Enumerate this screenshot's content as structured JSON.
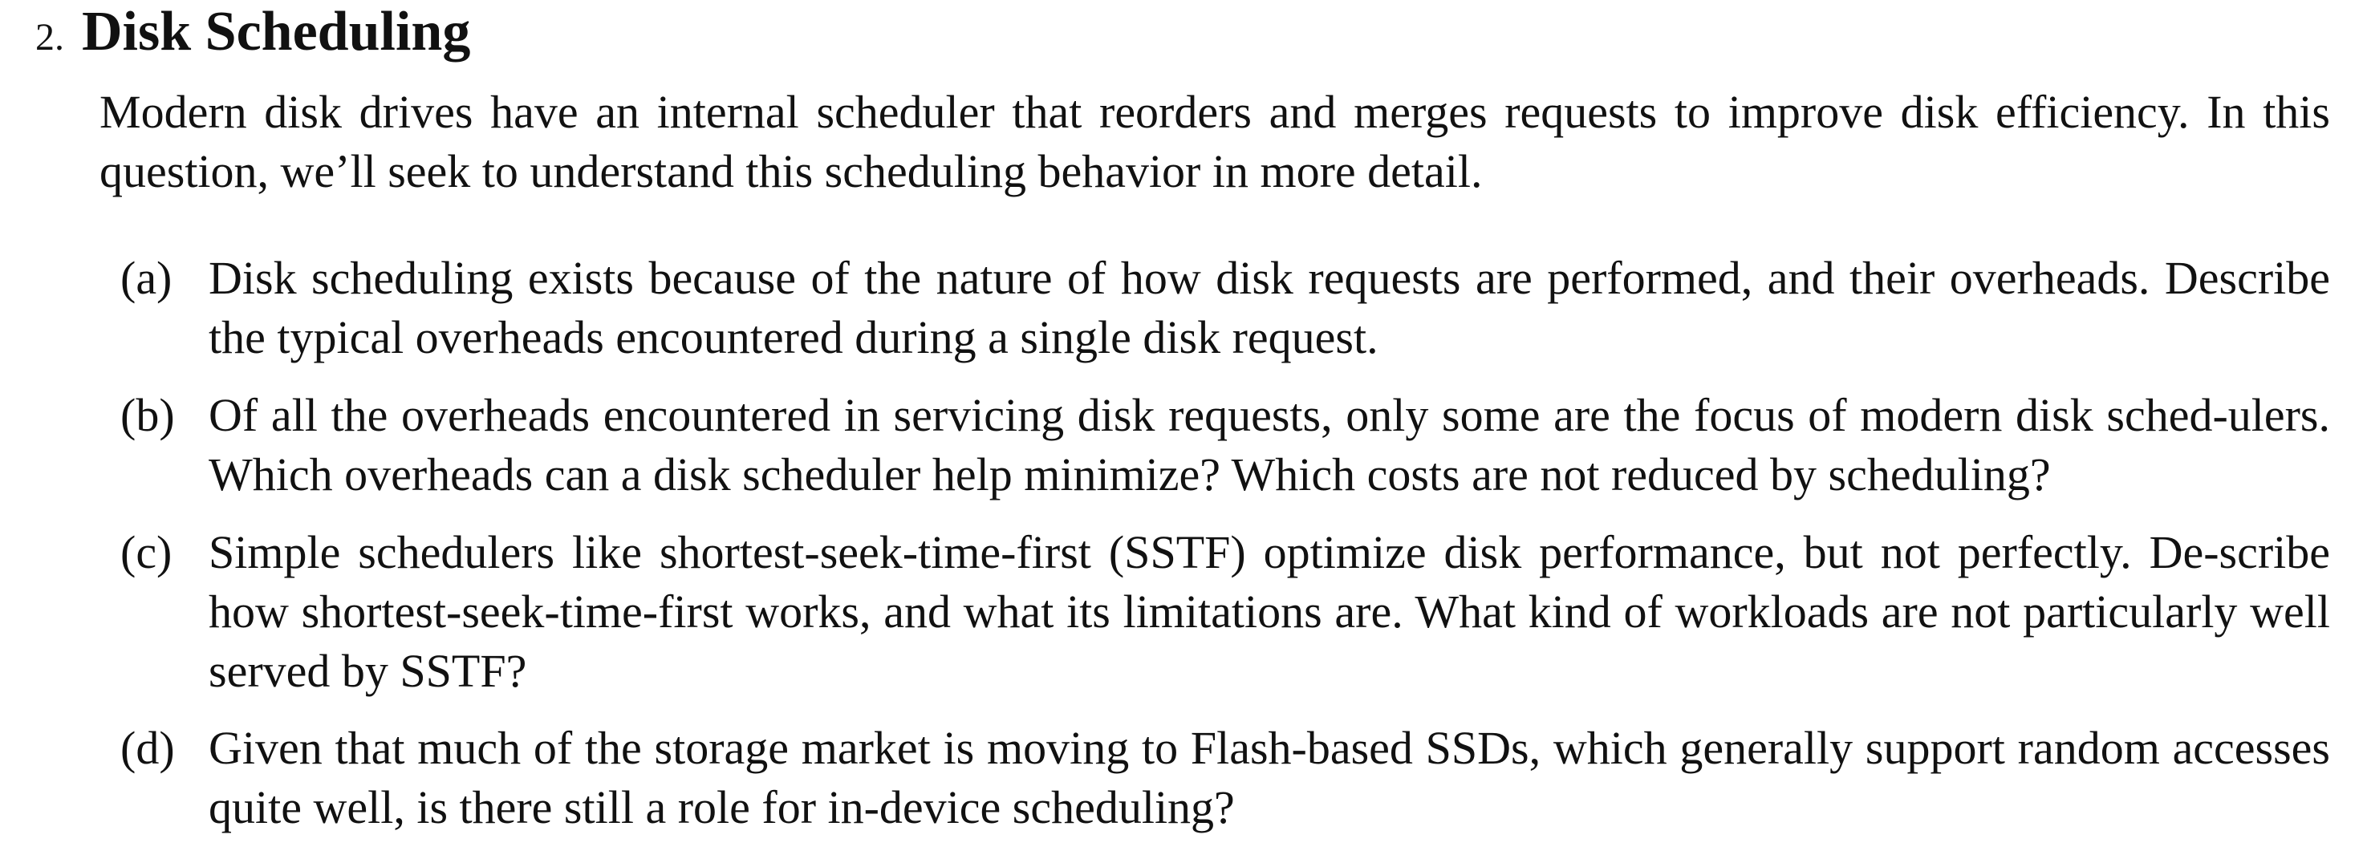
{
  "section": {
    "number": "2.",
    "title": "Disk Scheduling"
  },
  "intro": "Modern disk drives have an internal scheduler that reorders and merges requests to improve disk efficiency. In this question, we’ll seek to understand this scheduling behavior in more detail.",
  "questions": [
    {
      "letter": "(a)",
      "text": "Disk scheduling exists because of the nature of how disk requests are performed, and their overheads. Describe the typical overheads encountered during a single disk request."
    },
    {
      "letter": "(b)",
      "text": "Of all the overheads encountered in servicing disk requests, only some are the focus of modern disk sched-ulers. Which overheads can a disk scheduler help minimize? Which costs are not reduced by scheduling?"
    },
    {
      "letter": "(c)",
      "text": "Simple schedulers like shortest-seek-time-first (SSTF) optimize disk performance, but not perfectly. De-scribe how shortest-seek-time-first works, and what its limitations are. What kind of workloads are not particularly well served by SSTF?"
    },
    {
      "letter": "(d)",
      "text": "Given that much of the storage market is moving to Flash-based SSDs, which generally support random accesses quite well, is there still a role for in-device scheduling?"
    }
  ]
}
